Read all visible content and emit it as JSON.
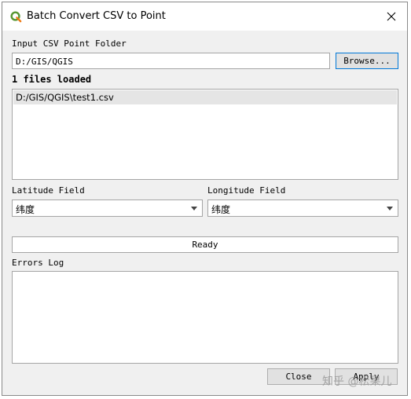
{
  "window": {
    "title": "Batch Convert CSV to Point"
  },
  "input": {
    "label": "Input CSV Point Folder",
    "value": "D:/GIS/QGIS",
    "browse_label": "Browse..."
  },
  "status": {
    "files_loaded": "1 files loaded"
  },
  "files": [
    "D:/GIS/QGIS\\test1.csv"
  ],
  "latitude": {
    "label": "Latitude Field",
    "value": "纬度"
  },
  "longitude": {
    "label": "Longitude Field",
    "value": "纬度"
  },
  "progress": {
    "text": "Ready"
  },
  "errors": {
    "label": "Errors Log",
    "content": ""
  },
  "buttons": {
    "close": "Close",
    "apply": "Apply"
  },
  "watermark": "知乎 @松果儿",
  "colors": {
    "accent": "#0078d7",
    "qgis_green": "#589632",
    "qgis_yellow": "#ee7913"
  }
}
